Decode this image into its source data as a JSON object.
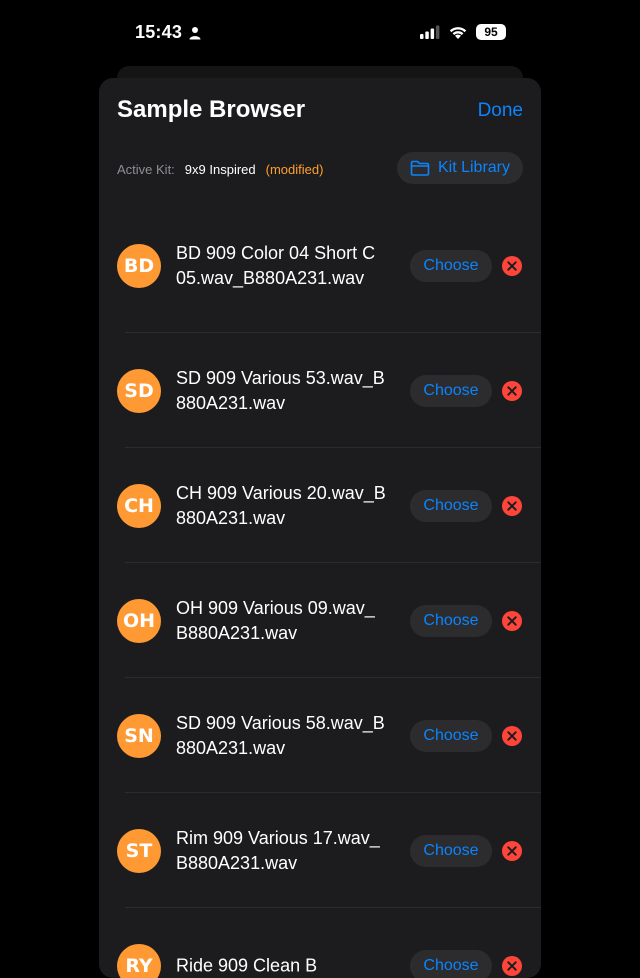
{
  "status_bar": {
    "time": "15:43",
    "battery": "95"
  },
  "header": {
    "title": "Sample Browser",
    "done_label": "Done"
  },
  "kit": {
    "label": "Active Kit:",
    "name": "9x9 Inspired",
    "modified": "(modified)",
    "library_label": "Kit Library"
  },
  "rows": [
    {
      "abbr": "BD",
      "name": "BD 909 Color 04 Short C 05.wav_B880A231.wav",
      "choose": "Choose"
    },
    {
      "abbr": "SD",
      "name": "SD 909 Various 53.wav_B880A231.wav",
      "choose": "Choose"
    },
    {
      "abbr": "CH",
      "name": "CH 909 Various 20.wav_B880A231.wav",
      "choose": "Choose"
    },
    {
      "abbr": "OH",
      "name": "OH 909 Various 09.wav_B880A231.wav",
      "choose": "Choose"
    },
    {
      "abbr": "SN",
      "name": "SD 909 Various 58.wav_B880A231.wav",
      "choose": "Choose"
    },
    {
      "abbr": "ST",
      "name": "Rim 909 Various 17.wav_B880A231.wav",
      "choose": "Choose"
    },
    {
      "abbr": "RY",
      "name": "Ride 909 Clean B",
      "choose": "Choose"
    }
  ],
  "colors": {
    "accent": "#0a84ff",
    "avatar": "#ff9933",
    "modified": "#ff9f2e",
    "remove": "#ff453a"
  }
}
